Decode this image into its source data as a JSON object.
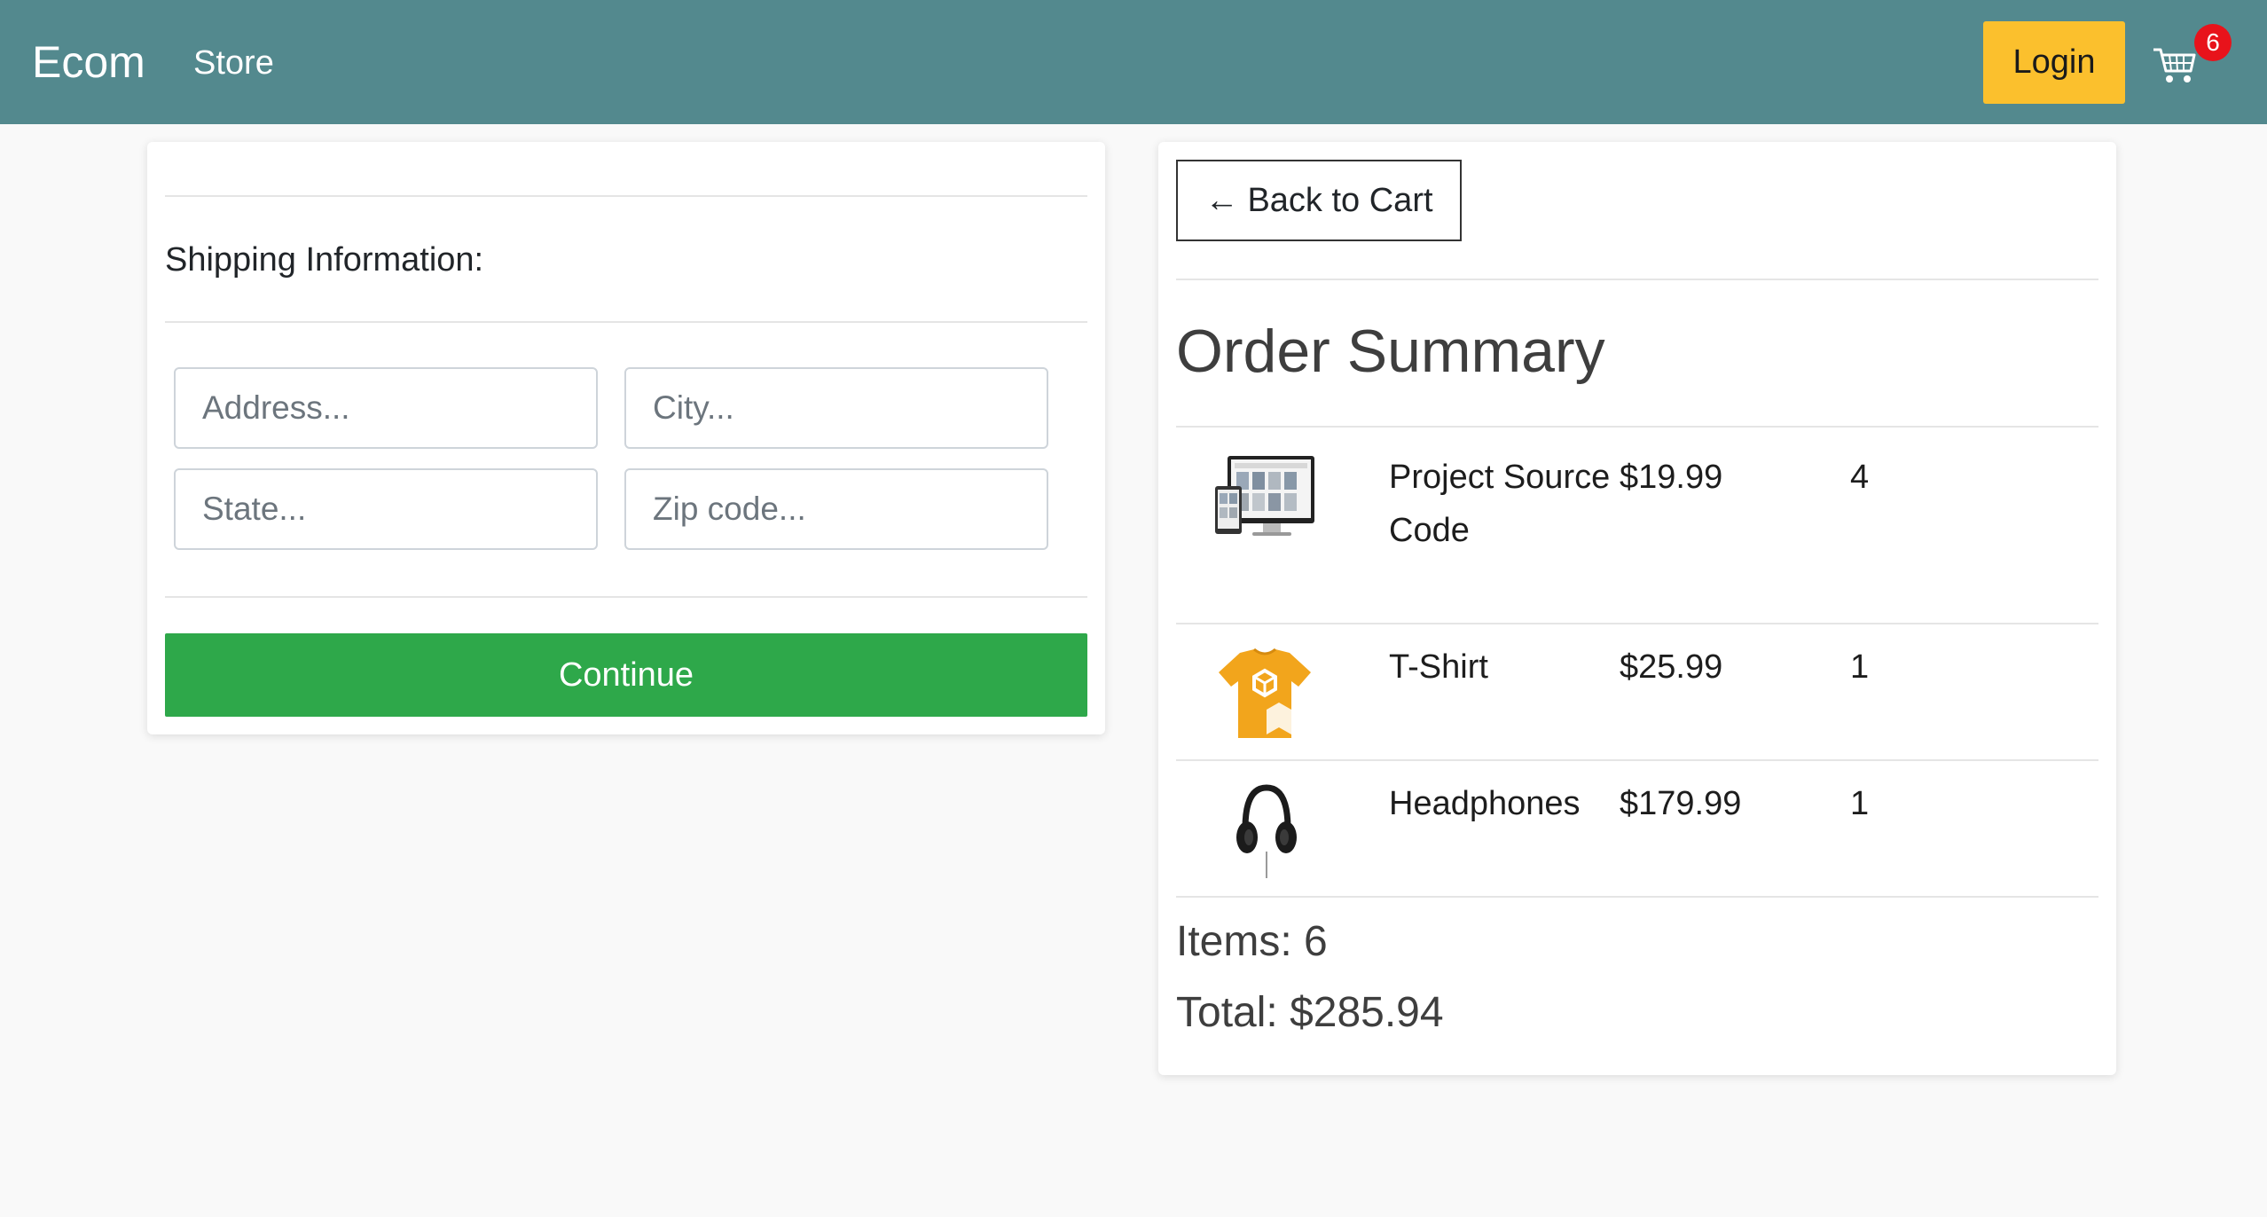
{
  "nav": {
    "brand": "Ecom",
    "store_link": "Store",
    "login_label": "Login",
    "cart_count": "6"
  },
  "shipping": {
    "heading": "Shipping Information:",
    "address_placeholder": "Address...",
    "city_placeholder": "City...",
    "state_placeholder": "State...",
    "zip_placeholder": "Zip code...",
    "continue_label": "Continue"
  },
  "summary": {
    "back_label": "Back to Cart",
    "title": "Order Summary",
    "items": [
      {
        "name": "Project Source Code",
        "price": "$19.99",
        "qty": "4",
        "image": "website-mockup-image"
      },
      {
        "name": "T-Shirt",
        "price": "$25.99",
        "qty": "1",
        "image": "yellow-tshirt-image"
      },
      {
        "name": "Headphones",
        "price": "$179.99",
        "qty": "1",
        "image": "headphones-image"
      }
    ],
    "items_text": "Items: 6",
    "total_text": "Total: $285.94"
  },
  "colors": {
    "navbar": "#53898e",
    "login": "#fbc02d",
    "continue": "#2ea84a",
    "badge": "#e8131b"
  }
}
